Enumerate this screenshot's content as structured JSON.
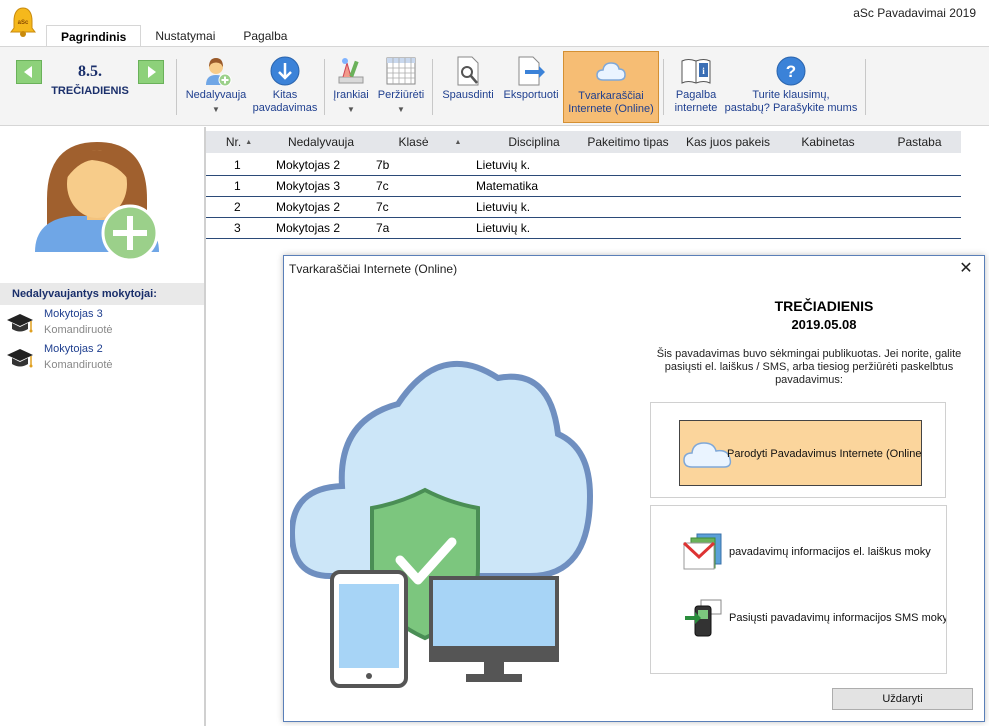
{
  "app": {
    "title": "aSc Pavadavimai 2019"
  },
  "tabs": [
    {
      "label": "Pagrindinis"
    },
    {
      "label": "Nustatymai"
    },
    {
      "label": "Pagalba"
    }
  ],
  "ribbon": {
    "day_number": "8.5.",
    "day_name": "TREČIADIENIS",
    "buttons": {
      "absent": "Nedalyvauja",
      "next_sub": "Kitas\npavadavimas",
      "tools": "Įrankiai",
      "view": "Peržiūrėti",
      "print": "Spausdinti",
      "export": "Eksportuoti",
      "online": "Tvarkaraščiai\nInternete (Online)",
      "help_online": "Pagalba\ninternete",
      "questions": "Turite klausimų,\npastabų? Parašykite mums"
    }
  },
  "left_panel": {
    "header": "Nedalyvaujantys mokytojai:",
    "items": [
      {
        "name": "Mokytojas 3",
        "reason": "Komandiruotė"
      },
      {
        "name": "Mokytojas 2",
        "reason": "Komandiruotė"
      }
    ]
  },
  "grid": {
    "columns": [
      "Nr.",
      "Nedalyvauja",
      "Klasė",
      "Disciplina",
      "Pakeitimo tipas",
      "Kas juos pakeis",
      "Kabinetas",
      "Pastaba"
    ],
    "rows": [
      {
        "nr": "1",
        "absent": "Mokytojas 2",
        "class": "7b",
        "subject": "Lietuvių k."
      },
      {
        "nr": "1",
        "absent": "Mokytojas 3",
        "class": "7c",
        "subject": "Matematika"
      },
      {
        "nr": "2",
        "absent": "Mokytojas 2",
        "class": "7c",
        "subject": "Lietuvių k."
      },
      {
        "nr": "3",
        "absent": "Mokytojas 2",
        "class": "7a",
        "subject": "Lietuvių k."
      }
    ]
  },
  "dialog": {
    "title": "Tvarkaraščiai Internete (Online)",
    "day": "TREČIADIENIS",
    "date": "2019.05.08",
    "message": "Šis pavadavimas buvo sėkmingai publikuotas. Jei norite, galite pasiųsti el. laiškus / SMS, arba tiesiog peržiūrėti paskelbtus pavadavimus:",
    "show_online": "Parodyti Pavadavimus Internete (Online)",
    "send_email": "pavadavimų informacijos el. laiškus moky",
    "send_sms": "Pasiųsti pavadavimų informacijos SMS mokyto",
    "close": "Uždaryti"
  },
  "colors": {
    "accent_online": "#f6bd74",
    "nav_green": "#8dd17a",
    "link_blue": "#1f3f8f",
    "dialog_border": "#5a7fb8"
  },
  "icons": [
    "bell-icon",
    "arrow-left-icon",
    "arrow-right-icon",
    "teacher-add-icon",
    "arrow-down-icon",
    "tools-icon",
    "grid-view-icon",
    "print-preview-icon",
    "export-icon",
    "cloud-icon",
    "book-info-icon",
    "question-icon",
    "graduation-cap-icon",
    "close-icon",
    "mail-icon",
    "sms-phone-icon",
    "shield-check-icon"
  ]
}
